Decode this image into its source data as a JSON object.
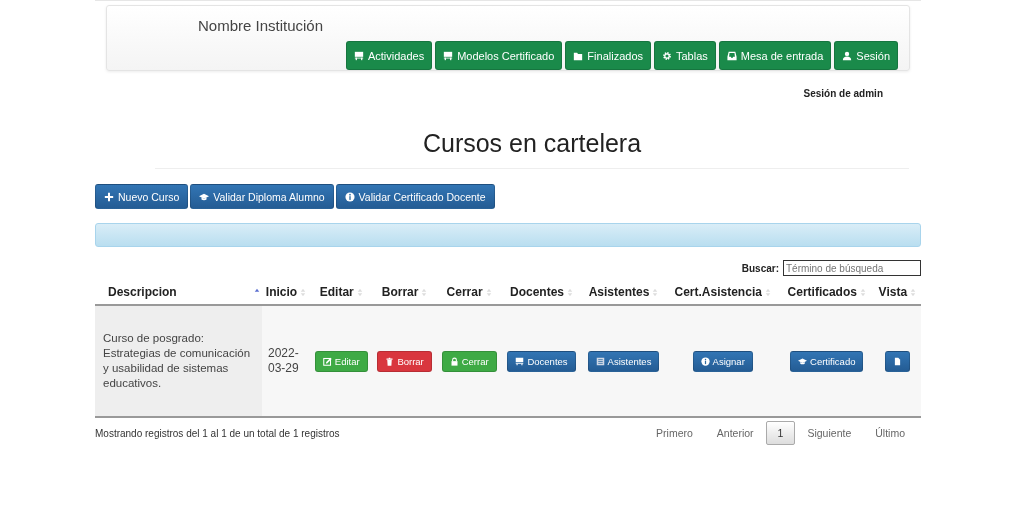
{
  "navbar": {
    "brand": "Nombre Institución",
    "items": [
      {
        "label": "Actividades",
        "kind": "board"
      },
      {
        "label": "Modelos Certificado",
        "kind": "board"
      },
      {
        "label": "Finalizados",
        "kind": "folder"
      },
      {
        "label": "Tablas",
        "kind": "gear"
      },
      {
        "label": "Mesa de entrada",
        "kind": "inbox"
      },
      {
        "label": "Sesión",
        "kind": "user"
      }
    ]
  },
  "session_text": "Sesión de admin",
  "page_title": "Cursos en cartelera",
  "toolbar": [
    {
      "label": "Nuevo Curso",
      "kind": "plus"
    },
    {
      "label": "Validar Diploma Alumno",
      "kind": "cap"
    },
    {
      "label": "Validar Certificado Docente",
      "kind": "info"
    }
  ],
  "search": {
    "label": "Buscar:",
    "placeholder": "Término de búsqueda"
  },
  "table": {
    "columns": [
      {
        "label": "Descripcion",
        "sorted": true
      },
      {
        "label": "Inicio",
        "sorted": false
      },
      {
        "label": "Editar",
        "sorted": false
      },
      {
        "label": "Borrar",
        "sorted": false
      },
      {
        "label": "Cerrar",
        "sorted": false
      },
      {
        "label": "Docentes",
        "sorted": false
      },
      {
        "label": "Asistentes",
        "sorted": false
      },
      {
        "label": "Cert.Asistencia",
        "sorted": false
      },
      {
        "label": "Certificados",
        "sorted": false
      },
      {
        "label": "Vista",
        "sorted": false
      }
    ],
    "rows": [
      {
        "descripcion": "Curso de posgrado: Estrategias de comunicación y usabilidad de sistemas educativos.",
        "inicio": "2022-03-29",
        "actions": [
          {
            "label": "Editar",
            "kind": "edit"
          },
          {
            "label": "Borrar",
            "kind": "delete"
          },
          {
            "label": "Cerrar",
            "kind": "close"
          },
          {
            "label": "Docentes",
            "kind": "teachers"
          },
          {
            "label": "Asistentes",
            "kind": "attendees"
          },
          {
            "label": "Asignar",
            "kind": "assign"
          },
          {
            "label": "Certificado",
            "kind": "certificate"
          },
          {
            "kind": "view"
          }
        ]
      }
    ]
  },
  "info": "Mostrando registros del 1 al 1 de un total de 1 registros",
  "pagination": [
    {
      "label": "Primero",
      "selected": false
    },
    {
      "label": "Anterior",
      "selected": false
    },
    {
      "label": "1",
      "selected": true
    },
    {
      "label": "Siguiente",
      "selected": false
    },
    {
      "label": "Último",
      "selected": false
    }
  ]
}
